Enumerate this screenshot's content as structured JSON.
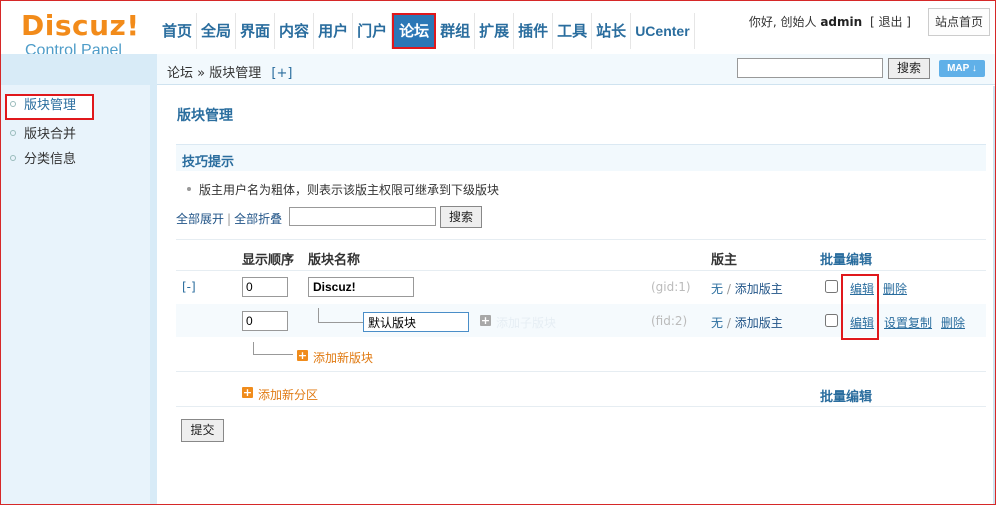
{
  "header": {
    "brand": "Discuz!",
    "subtitle": "Control Panel",
    "nav": [
      "首页",
      "全局",
      "界面",
      "内容",
      "用户",
      "门户",
      "论坛",
      "群组",
      "扩展",
      "插件",
      "工具",
      "站长",
      "UCenter"
    ],
    "active_nav": "论坛",
    "greeting_prefix": "你好, 创始人",
    "username": "admin",
    "logout": "[ 退出 ]",
    "site_home": "站点首页"
  },
  "sidebar": {
    "items": [
      {
        "label": "版块管理",
        "active": true
      },
      {
        "label": "版块合并",
        "active": false
      },
      {
        "label": "分类信息",
        "active": false
      }
    ]
  },
  "breadcrumb": {
    "root": "论坛",
    "sep": "»",
    "current": "版块管理",
    "add": "[+]"
  },
  "topbar": {
    "search_button": "搜索",
    "map_button": "MAP ↓"
  },
  "main": {
    "title": "版块管理",
    "tips_title": "技巧提示",
    "tip": "版主用户名为粗体，则表示该版主权限可继承到下级版块",
    "expand_all": "全部展开",
    "collapse_all": "全部折叠",
    "search_button": "搜索",
    "columns": {
      "order": "显示顺序",
      "name": "版块名称",
      "moderator": "版主",
      "batch_edit": "批量编辑"
    },
    "rows": [
      {
        "toggle": "[-]",
        "order": "0",
        "name": "Discuz!",
        "id_label": "(gid:1)",
        "moderator_none": "无",
        "add_moderator": "添加版主",
        "actions": [
          "编辑",
          "删除"
        ]
      },
      {
        "order": "0",
        "name": "默认版块",
        "add_child": "添加子版块",
        "id_label": "(fid:2)",
        "moderator_none": "无",
        "add_moderator": "添加版主",
        "actions": [
          "编辑",
          "设置复制",
          "删除"
        ]
      }
    ],
    "add_forum": "添加新版块",
    "add_group": "添加新分区",
    "batch_edit_bottom": "批量编辑",
    "submit": "提交"
  }
}
